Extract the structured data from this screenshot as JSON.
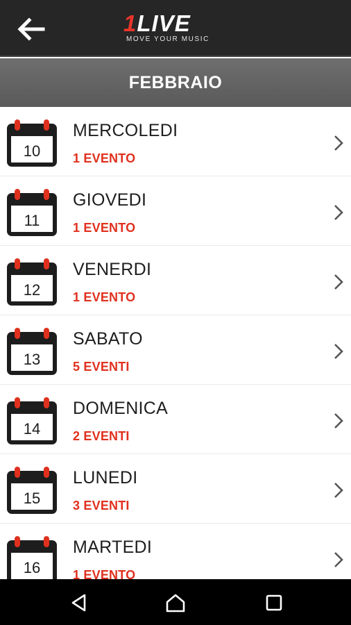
{
  "header": {
    "logo_main": "1LIVE",
    "logo_tagline": "MOVE YOUR MUSIC",
    "back_icon": "arrow-left-icon"
  },
  "month": {
    "title": "FEBBRAIO"
  },
  "days": [
    {
      "date": "10",
      "weekday": "MERCOLEDI",
      "events": "1 EVENTO"
    },
    {
      "date": "11",
      "weekday": "GIOVEDI",
      "events": "1 EVENTO"
    },
    {
      "date": "12",
      "weekday": "VENERDI",
      "events": "1 EVENTO"
    },
    {
      "date": "13",
      "weekday": "SABATO",
      "events": "5 EVENTI"
    },
    {
      "date": "14",
      "weekday": "DOMENICA",
      "events": "2 EVENTI"
    },
    {
      "date": "15",
      "weekday": "LUNEDI",
      "events": "3 EVENTI"
    },
    {
      "date": "16",
      "weekday": "MARTEDI",
      "events": "1 EVENTO"
    }
  ],
  "colors": {
    "accent_red": "#e0301e",
    "topbar": "#262626",
    "month_bar": "#636363"
  },
  "navbar": {
    "icons": [
      "back-triangle-icon",
      "home-icon",
      "recents-square-icon"
    ]
  }
}
